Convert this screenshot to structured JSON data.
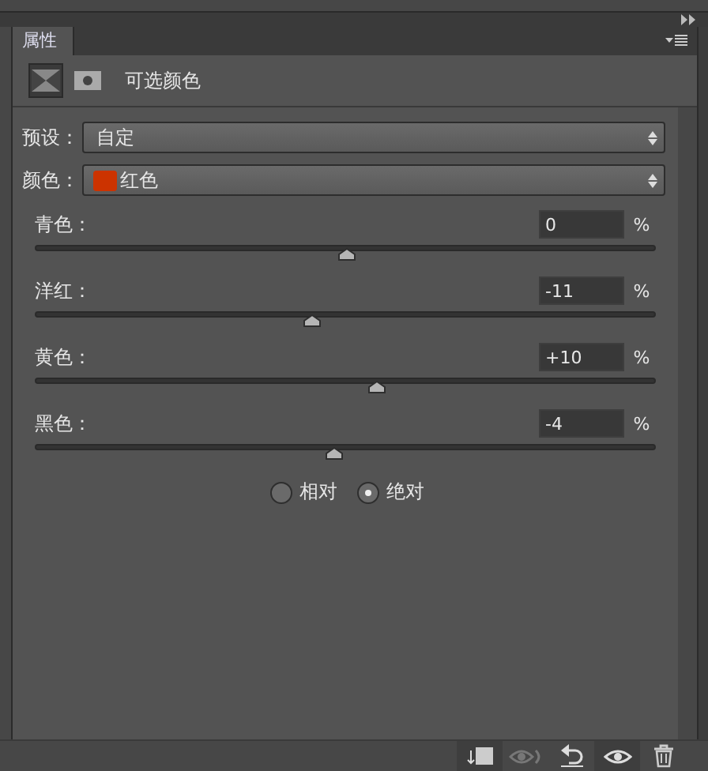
{
  "panel_tab": {
    "label": "属性",
    "selected": true
  },
  "header": {
    "title": "可选颜色"
  },
  "preset": {
    "label": "预设：",
    "value": "自定"
  },
  "colors": {
    "label": "颜色：",
    "value": "红色",
    "color": "#cc3300"
  },
  "sliders": [
    {
      "label": "青色：",
      "value": "0",
      "unit": "%",
      "level": 0.5
    },
    {
      "label": "洋红：",
      "value": "-11",
      "unit": "%",
      "level": 0.445
    },
    {
      "label": "黄色：",
      "value": "+10",
      "unit": "%",
      "level": 0.55
    },
    {
      "label": "黑色：",
      "value": "-4",
      "unit": "%",
      "level": 0.48
    }
  ],
  "method": [
    {
      "label": "相对",
      "selected": false
    },
    {
      "label": "绝对",
      "selected": true
    }
  ]
}
